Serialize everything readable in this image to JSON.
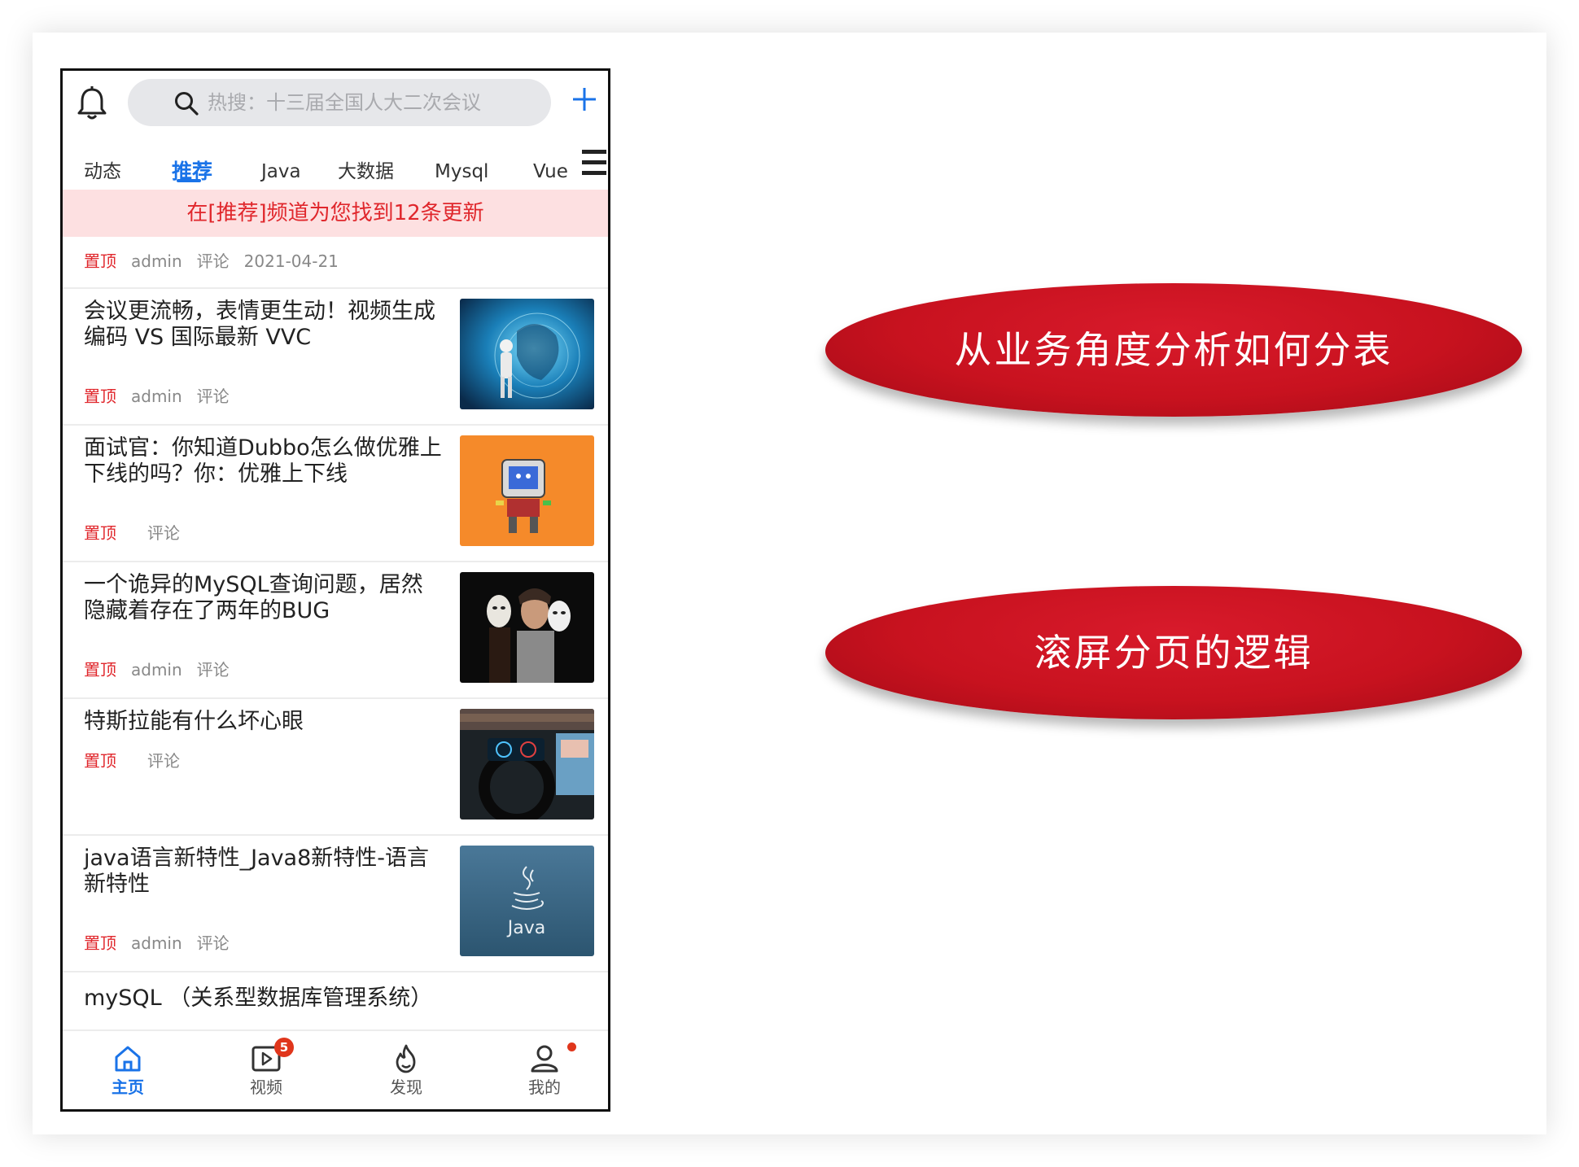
{
  "search": {
    "placeholder_text": "热搜：十三届全国人大二次会议"
  },
  "tabs": [
    "动态",
    "推荐",
    "Java",
    "大数据",
    "Mysql",
    "Vue"
  ],
  "notice": "在[推荐]频道为您找到12条更新",
  "articles": [
    {
      "title": "",
      "pin": "置顶",
      "author": "admin",
      "comment": "评论",
      "date": "2021-04-21",
      "image": "none"
    },
    {
      "title": "会议更流畅，表情更生动！视频生成编码 VS 国际最新 VVC",
      "pin": "置顶",
      "author": "admin",
      "comment": "评论",
      "date": "",
      "image": "globe-tech-thumbnail"
    },
    {
      "title": "面试官：你知道Dubbo怎么做优雅上下线的吗？你：优雅上下线",
      "pin": "置顶",
      "author": "",
      "comment": "评论",
      "date": "",
      "image": "robot-thumbnail"
    },
    {
      "title": "一个诡异的MySQL查询问题，居然隐藏着存在了两年的BUG",
      "pin": "置顶",
      "author": "admin",
      "comment": "评论",
      "date": "",
      "image": "masks-thumbnail"
    },
    {
      "title": "特斯拉能有什么坏心眼",
      "pin": "置顶",
      "author": "",
      "comment": "评论",
      "date": "",
      "image": "tesla-dashboard-thumbnail"
    },
    {
      "title": "java语言新特性_Java8新特性-语言新特性",
      "pin": "置顶",
      "author": "admin",
      "comment": "评论",
      "date": "",
      "image": "java-logo-thumbnail",
      "image_text": "Java"
    },
    {
      "title": "mySQL （关系型数据库管理系统）",
      "pin": "",
      "author": "",
      "comment": "",
      "date": "",
      "image": "none"
    }
  ],
  "tabbar": [
    {
      "label": "主页",
      "icon": "home-icon",
      "active": true
    },
    {
      "label": "视频",
      "icon": "video-icon",
      "badge": "5"
    },
    {
      "label": "发现",
      "icon": "discover-icon"
    },
    {
      "label": "我的",
      "icon": "profile-icon",
      "dot": true
    }
  ],
  "annotations": [
    "从业务角度分析如何分表",
    "滚屏分页的逻辑"
  ],
  "colors": {
    "accent": "#1a73e8",
    "highlight_red": "#e0272c",
    "notice_bg": "#fde0e1",
    "annotation_red": "#c8121f"
  }
}
